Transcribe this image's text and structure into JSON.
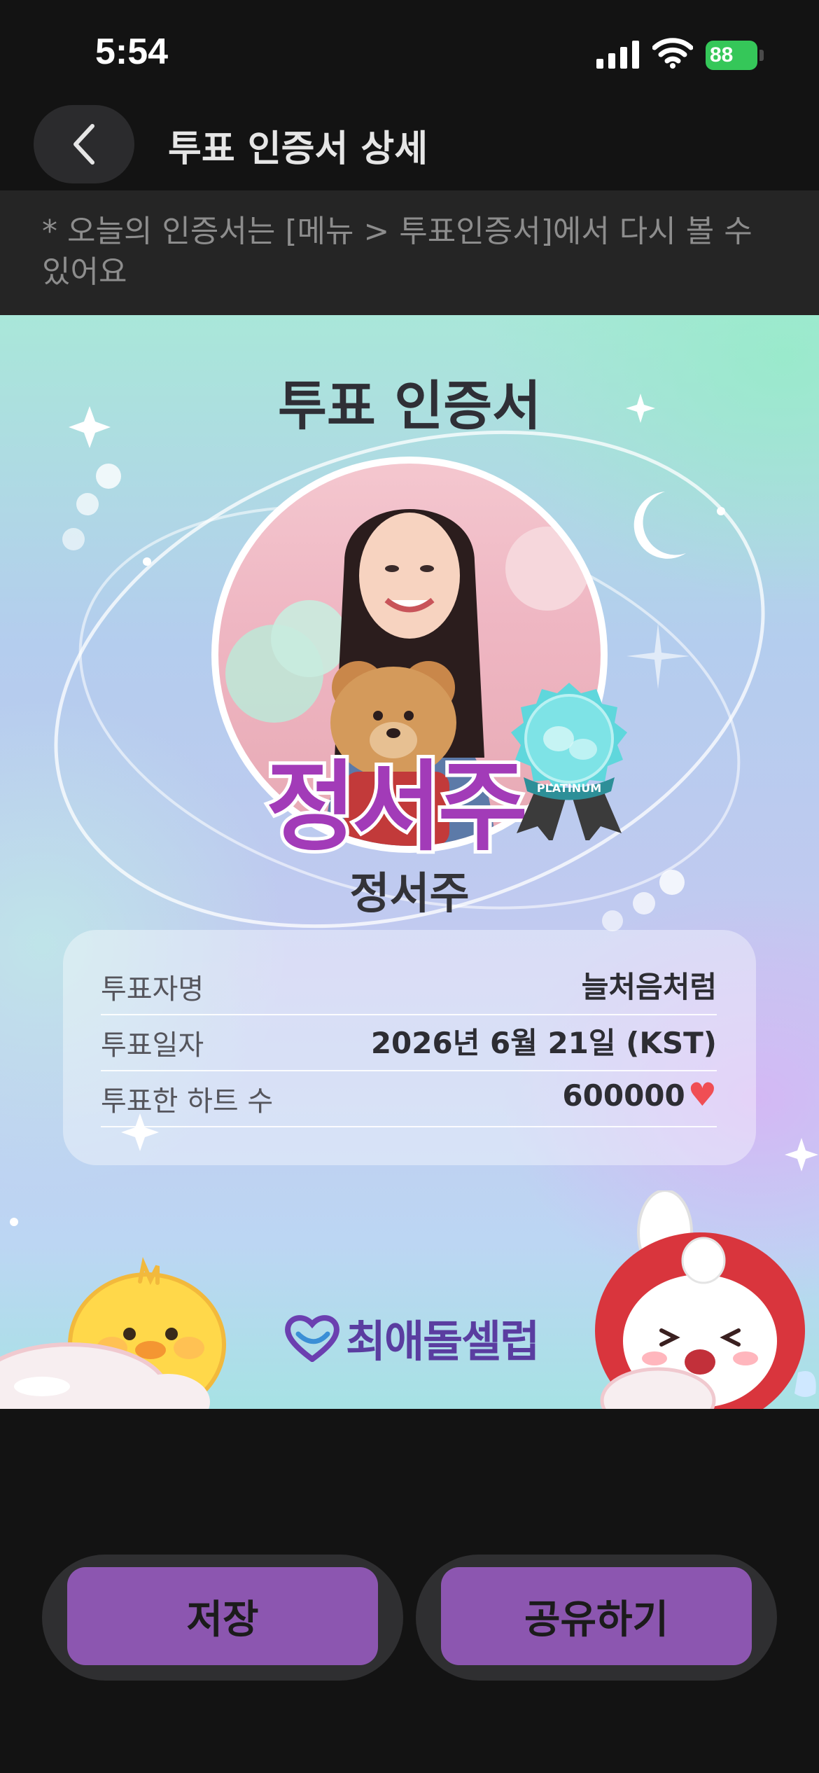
{
  "status_bar": {
    "time": "5:54",
    "battery": "88"
  },
  "header": {
    "title": "투표 인증서 상세",
    "back_icon": "chevron-left-icon"
  },
  "notice": {
    "text": "* 오늘의 인증서는 [메뉴 > 투표인증서]에서 다시 볼 수 있어요"
  },
  "certificate": {
    "title": "투표 인증서",
    "photo_overlay_name": "정서주",
    "badge_label": "PLATINUM",
    "name": "정서주",
    "rows": [
      {
        "label": "투표자명",
        "value": "늘처음처럼"
      },
      {
        "label": "투표일자",
        "value": "2026년 6월 21일 (KST)"
      },
      {
        "label": "투표한 하트 수",
        "value": "600000"
      }
    ],
    "heart_icon": "heart-icon",
    "logo_text": "최애돌셀럽"
  },
  "actions": {
    "save_label": "저장",
    "share_label": "공유하기"
  },
  "colors": {
    "accent": "#8c56b0",
    "heart": "#f04e54",
    "battery": "#35c759"
  }
}
